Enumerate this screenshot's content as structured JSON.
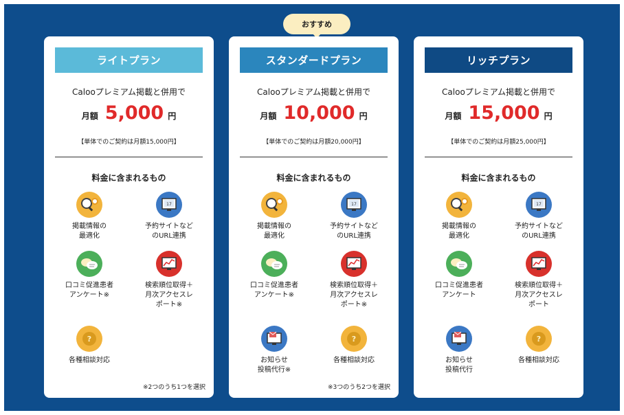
{
  "recommend_badge": "おすすめ",
  "plans": [
    {
      "name": "ライトプラン",
      "head_color": "#5bbad9",
      "combo_text": "Calooプレミアム掲載と併用で",
      "price_prefix": "月額",
      "price": "5,000",
      "price_suffix": "円",
      "single_price": "【単体でのご契約は月額15,000円】",
      "included_title": "料金に含まれるもの",
      "features": [
        {
          "icon": "magnifier-gear-icon",
          "label": "掲載情報の\n最適化"
        },
        {
          "icon": "calendar-monitor-icon",
          "label": "予約サイトなど\nのURL連携"
        },
        {
          "icon": "chat-bubbles-icon",
          "label": "口コミ促進患者\nアンケート※"
        },
        {
          "icon": "chart-monitor-icon",
          "label": "検索順位取得＋\n月次アクセスレ\nポート※"
        },
        {
          "icon": "question-icon",
          "label": "各種相談対応"
        }
      ],
      "note": "※2つのうち1つを選択"
    },
    {
      "name": "スタンダードプラン",
      "head_color": "#2b86bd",
      "combo_text": "Calooプレミアム掲載と併用で",
      "price_prefix": "月額",
      "price": "10,000",
      "price_suffix": "円",
      "single_price": "【単体でのご契約は月額20,000円】",
      "included_title": "料金に含まれるもの",
      "features": [
        {
          "icon": "magnifier-gear-icon",
          "label": "掲載情報の\n最適化"
        },
        {
          "icon": "calendar-monitor-icon",
          "label": "予約サイトなど\nのURL連携"
        },
        {
          "icon": "chat-bubbles-icon",
          "label": "口コミ促進患者\nアンケート※"
        },
        {
          "icon": "chart-monitor-icon",
          "label": "検索順位取得＋\n月次アクセスレ\nポート※"
        },
        {
          "icon": "mail-monitor-icon",
          "label": "お知らせ\n投稿代行※"
        },
        {
          "icon": "question-icon",
          "label": "各種相談対応"
        }
      ],
      "note": "※3つのうち2つを選択"
    },
    {
      "name": "リッチプラン",
      "head_color": "#0f4a84",
      "combo_text": "Calooプレミアム掲載と併用で",
      "price_prefix": "月額",
      "price": "15,000",
      "price_suffix": "円",
      "single_price": "【単体でのご契約は月額25,000円】",
      "included_title": "料金に含まれるもの",
      "features": [
        {
          "icon": "magnifier-gear-icon",
          "label": "掲載情報の\n最適化"
        },
        {
          "icon": "calendar-monitor-icon",
          "label": "予約サイトなど\nのURL連携"
        },
        {
          "icon": "chat-bubbles-icon",
          "label": "口コミ促進患者\nアンケート"
        },
        {
          "icon": "chart-monitor-icon",
          "label": "検索順位取得＋\n月次アクセスレ\nポート"
        },
        {
          "icon": "mail-monitor-icon",
          "label": "お知らせ\n投稿代行"
        },
        {
          "icon": "question-icon",
          "label": "各種相談対応"
        }
      ],
      "note": ""
    }
  ]
}
